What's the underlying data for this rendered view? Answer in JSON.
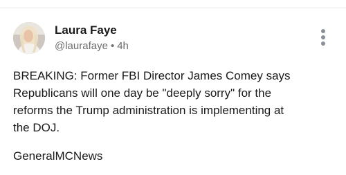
{
  "post": {
    "author": {
      "display_name": "Laura Faye",
      "handle": "@laurafaye",
      "separator": "•",
      "time_ago": "4h",
      "avatar_icon": "profile-photo"
    },
    "more_icon": "vertical-ellipsis-icon",
    "body_lines": [
      "BREAKING: Former FBI Director James Comey says",
      "Republicans will one day be \"deeply sorry\" for the",
      "reforms the Trump administration is implementing at",
      "the DOJ."
    ],
    "signature": "GeneralMCNews"
  },
  "colors": {
    "text_primary": "#1a1a1a",
    "text_secondary": "#6b6b6b",
    "icon_gray": "#8a8f98",
    "divider": "#e6e6e6"
  }
}
